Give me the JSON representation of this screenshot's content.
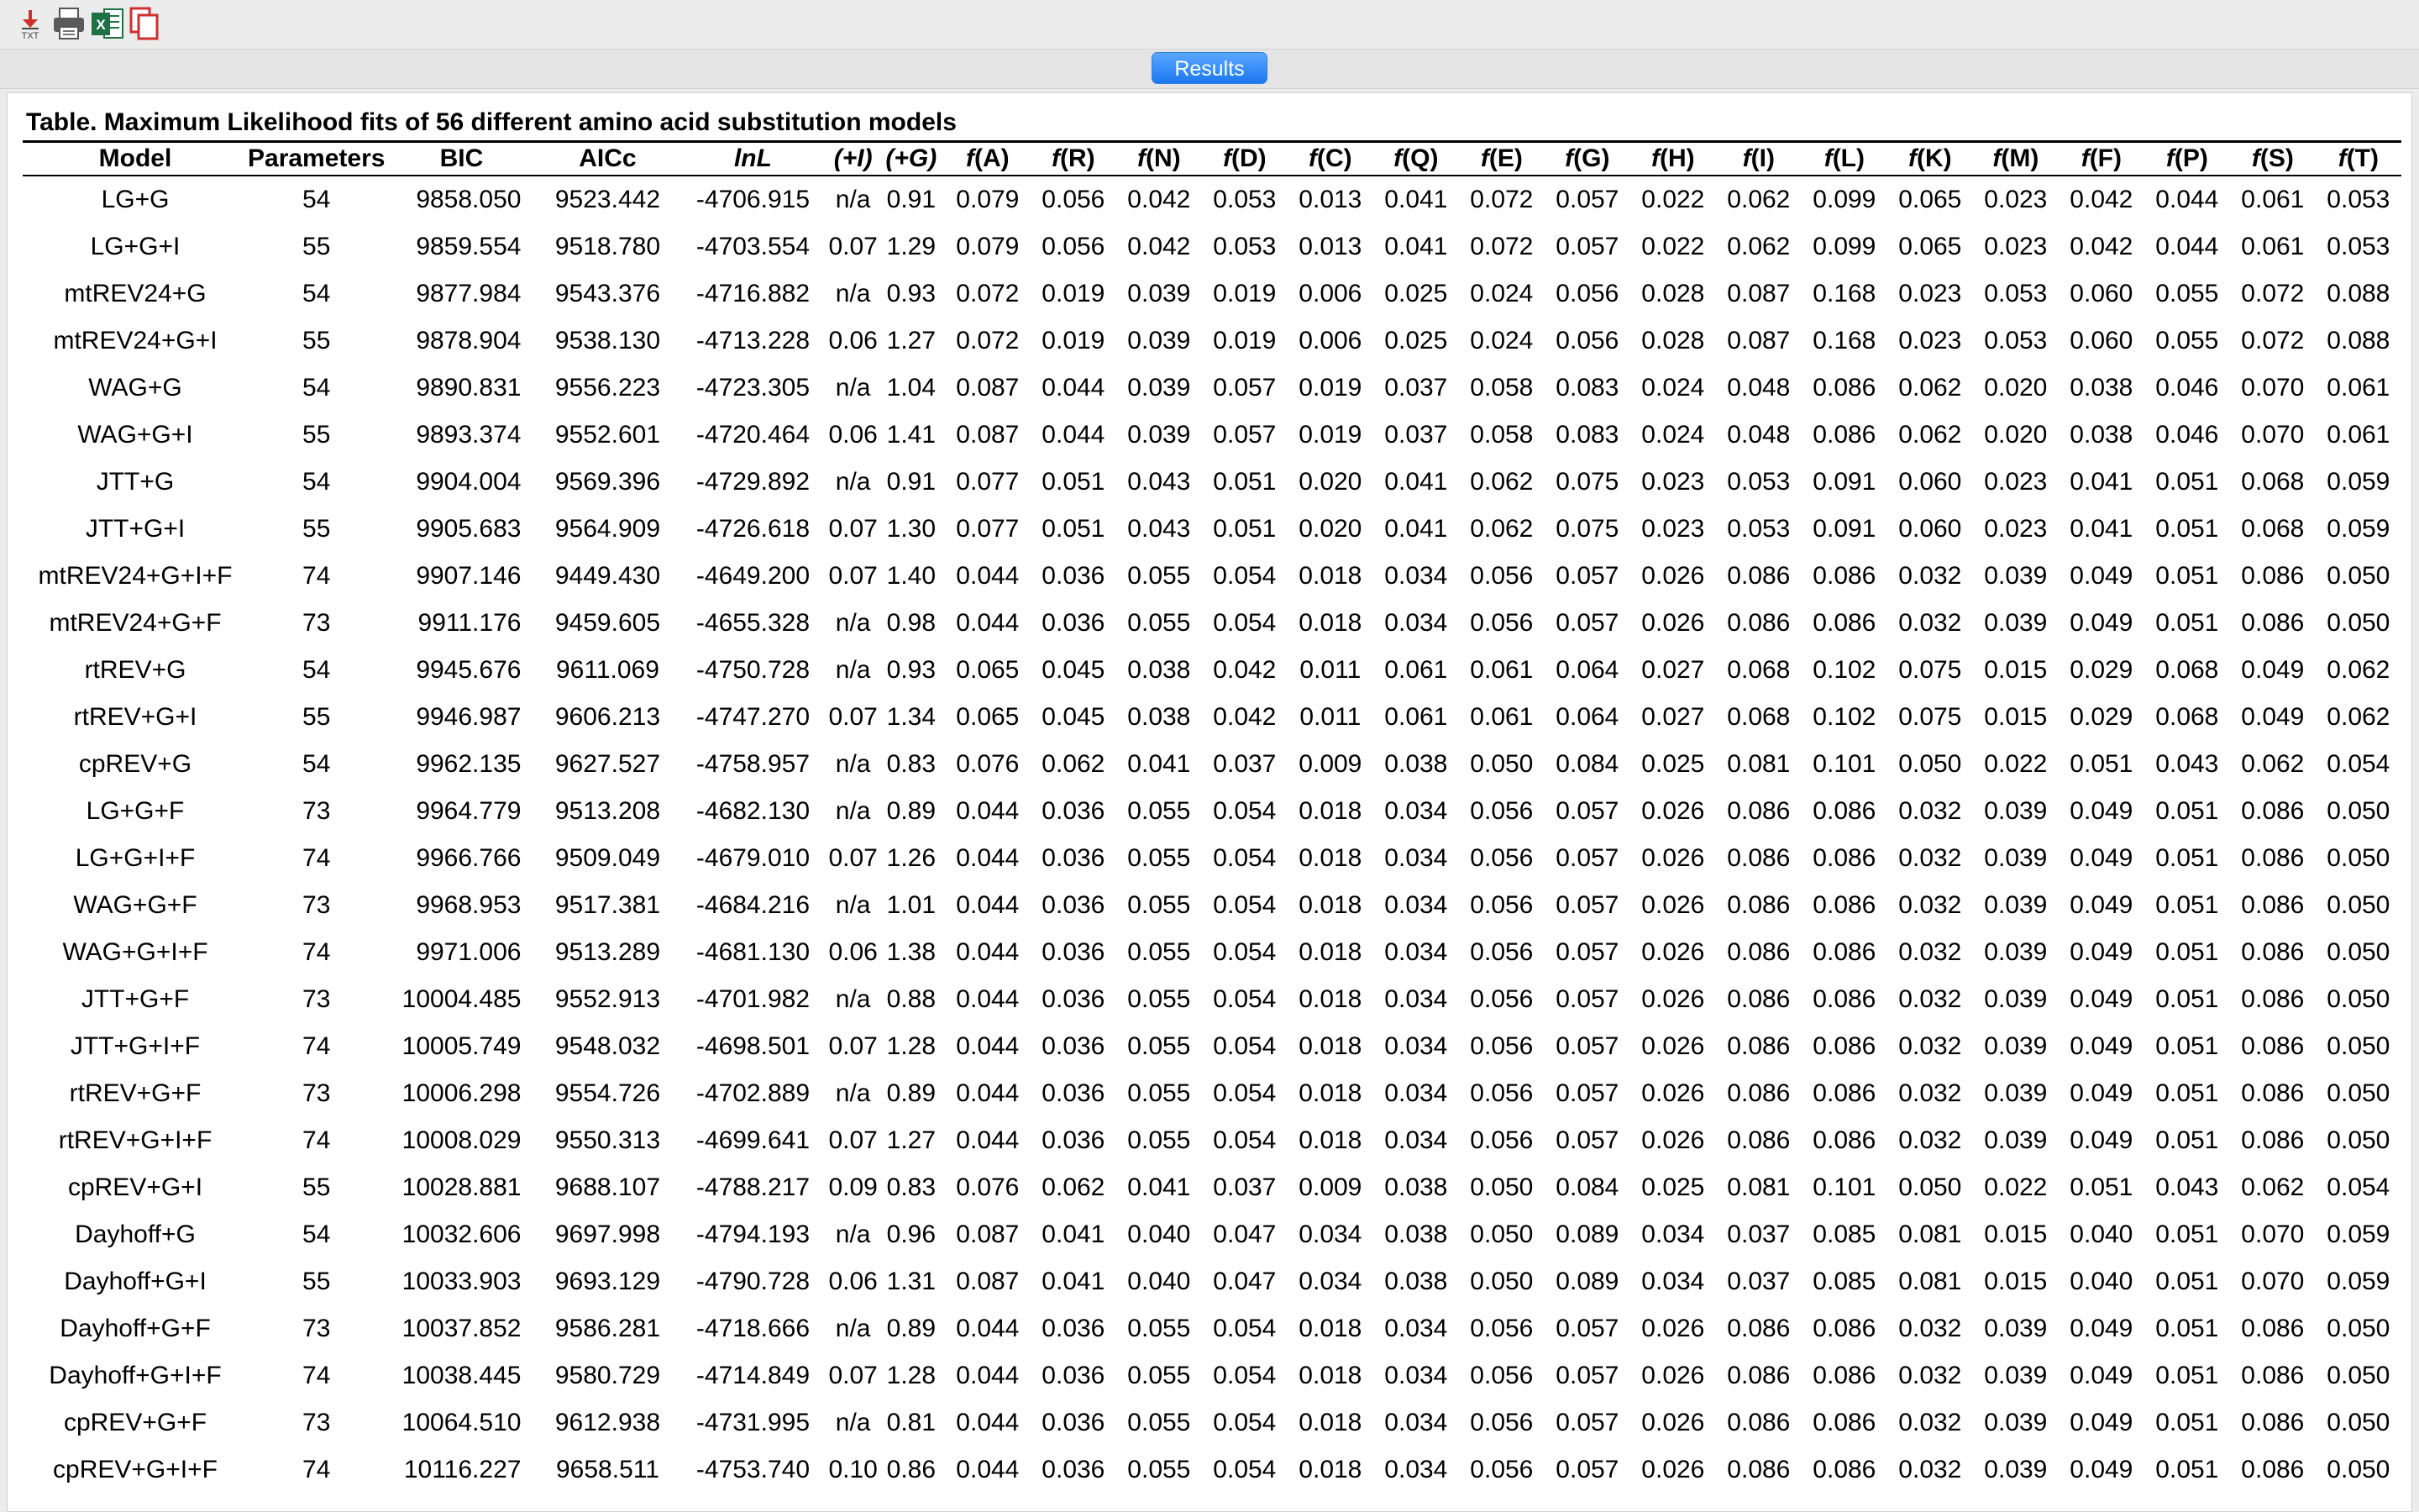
{
  "toolbar": {
    "buttons": [
      {
        "name": "export-txt-button",
        "icon": "txt-export-icon",
        "label": "TXT"
      },
      {
        "name": "print-button",
        "icon": "printer-icon"
      },
      {
        "name": "export-excel-button",
        "icon": "excel-icon",
        "label": "X"
      },
      {
        "name": "copy-button",
        "icon": "copy-icon"
      }
    ]
  },
  "tabs": {
    "active_label": "Results",
    "accent_color": "#1c78f0"
  },
  "table": {
    "caption": "Table. Maximum Likelihood fits of 56 different amino acid substitution models",
    "headers": [
      "Model",
      "Parameters",
      "BIC",
      "AICc",
      "lnL",
      "(+I)",
      "(+G)",
      "f(A)",
      "f(R)",
      "f(N)",
      "f(D)",
      "f(C)",
      "f(Q)",
      "f(E)",
      "f(G)",
      "f(H)",
      "f(I)",
      "f(L)",
      "f(K)",
      "f(M)",
      "f(F)",
      "f(P)",
      "f(S)",
      "f(T)"
    ],
    "rows": [
      [
        "LG+G",
        "54",
        "9858.050",
        "9523.442",
        "-4706.915",
        "n/a",
        "0.91",
        "0.079",
        "0.056",
        "0.042",
        "0.053",
        "0.013",
        "0.041",
        "0.072",
        "0.057",
        "0.022",
        "0.062",
        "0.099",
        "0.065",
        "0.023",
        "0.042",
        "0.044",
        "0.061",
        "0.053"
      ],
      [
        "LG+G+I",
        "55",
        "9859.554",
        "9518.780",
        "-4703.554",
        "0.07",
        "1.29",
        "0.079",
        "0.056",
        "0.042",
        "0.053",
        "0.013",
        "0.041",
        "0.072",
        "0.057",
        "0.022",
        "0.062",
        "0.099",
        "0.065",
        "0.023",
        "0.042",
        "0.044",
        "0.061",
        "0.053"
      ],
      [
        "mtREV24+G",
        "54",
        "9877.984",
        "9543.376",
        "-4716.882",
        "n/a",
        "0.93",
        "0.072",
        "0.019",
        "0.039",
        "0.019",
        "0.006",
        "0.025",
        "0.024",
        "0.056",
        "0.028",
        "0.087",
        "0.168",
        "0.023",
        "0.053",
        "0.060",
        "0.055",
        "0.072",
        "0.088"
      ],
      [
        "mtREV24+G+I",
        "55",
        "9878.904",
        "9538.130",
        "-4713.228",
        "0.06",
        "1.27",
        "0.072",
        "0.019",
        "0.039",
        "0.019",
        "0.006",
        "0.025",
        "0.024",
        "0.056",
        "0.028",
        "0.087",
        "0.168",
        "0.023",
        "0.053",
        "0.060",
        "0.055",
        "0.072",
        "0.088"
      ],
      [
        "WAG+G",
        "54",
        "9890.831",
        "9556.223",
        "-4723.305",
        "n/a",
        "1.04",
        "0.087",
        "0.044",
        "0.039",
        "0.057",
        "0.019",
        "0.037",
        "0.058",
        "0.083",
        "0.024",
        "0.048",
        "0.086",
        "0.062",
        "0.020",
        "0.038",
        "0.046",
        "0.070",
        "0.061"
      ],
      [
        "WAG+G+I",
        "55",
        "9893.374",
        "9552.601",
        "-4720.464",
        "0.06",
        "1.41",
        "0.087",
        "0.044",
        "0.039",
        "0.057",
        "0.019",
        "0.037",
        "0.058",
        "0.083",
        "0.024",
        "0.048",
        "0.086",
        "0.062",
        "0.020",
        "0.038",
        "0.046",
        "0.070",
        "0.061"
      ],
      [
        "JTT+G",
        "54",
        "9904.004",
        "9569.396",
        "-4729.892",
        "n/a",
        "0.91",
        "0.077",
        "0.051",
        "0.043",
        "0.051",
        "0.020",
        "0.041",
        "0.062",
        "0.075",
        "0.023",
        "0.053",
        "0.091",
        "0.060",
        "0.023",
        "0.041",
        "0.051",
        "0.068",
        "0.059"
      ],
      [
        "JTT+G+I",
        "55",
        "9905.683",
        "9564.909",
        "-4726.618",
        "0.07",
        "1.30",
        "0.077",
        "0.051",
        "0.043",
        "0.051",
        "0.020",
        "0.041",
        "0.062",
        "0.075",
        "0.023",
        "0.053",
        "0.091",
        "0.060",
        "0.023",
        "0.041",
        "0.051",
        "0.068",
        "0.059"
      ],
      [
        "mtREV24+G+I+F",
        "74",
        "9907.146",
        "9449.430",
        "-4649.200",
        "0.07",
        "1.40",
        "0.044",
        "0.036",
        "0.055",
        "0.054",
        "0.018",
        "0.034",
        "0.056",
        "0.057",
        "0.026",
        "0.086",
        "0.086",
        "0.032",
        "0.039",
        "0.049",
        "0.051",
        "0.086",
        "0.050"
      ],
      [
        "mtREV24+G+F",
        "73",
        "9911.176",
        "9459.605",
        "-4655.328",
        "n/a",
        "0.98",
        "0.044",
        "0.036",
        "0.055",
        "0.054",
        "0.018",
        "0.034",
        "0.056",
        "0.057",
        "0.026",
        "0.086",
        "0.086",
        "0.032",
        "0.039",
        "0.049",
        "0.051",
        "0.086",
        "0.050"
      ],
      [
        "rtREV+G",
        "54",
        "9945.676",
        "9611.069",
        "-4750.728",
        "n/a",
        "0.93",
        "0.065",
        "0.045",
        "0.038",
        "0.042",
        "0.011",
        "0.061",
        "0.061",
        "0.064",
        "0.027",
        "0.068",
        "0.102",
        "0.075",
        "0.015",
        "0.029",
        "0.068",
        "0.049",
        "0.062"
      ],
      [
        "rtREV+G+I",
        "55",
        "9946.987",
        "9606.213",
        "-4747.270",
        "0.07",
        "1.34",
        "0.065",
        "0.045",
        "0.038",
        "0.042",
        "0.011",
        "0.061",
        "0.061",
        "0.064",
        "0.027",
        "0.068",
        "0.102",
        "0.075",
        "0.015",
        "0.029",
        "0.068",
        "0.049",
        "0.062"
      ],
      [
        "cpREV+G",
        "54",
        "9962.135",
        "9627.527",
        "-4758.957",
        "n/a",
        "0.83",
        "0.076",
        "0.062",
        "0.041",
        "0.037",
        "0.009",
        "0.038",
        "0.050",
        "0.084",
        "0.025",
        "0.081",
        "0.101",
        "0.050",
        "0.022",
        "0.051",
        "0.043",
        "0.062",
        "0.054"
      ],
      [
        "LG+G+F",
        "73",
        "9964.779",
        "9513.208",
        "-4682.130",
        "n/a",
        "0.89",
        "0.044",
        "0.036",
        "0.055",
        "0.054",
        "0.018",
        "0.034",
        "0.056",
        "0.057",
        "0.026",
        "0.086",
        "0.086",
        "0.032",
        "0.039",
        "0.049",
        "0.051",
        "0.086",
        "0.050"
      ],
      [
        "LG+G+I+F",
        "74",
        "9966.766",
        "9509.049",
        "-4679.010",
        "0.07",
        "1.26",
        "0.044",
        "0.036",
        "0.055",
        "0.054",
        "0.018",
        "0.034",
        "0.056",
        "0.057",
        "0.026",
        "0.086",
        "0.086",
        "0.032",
        "0.039",
        "0.049",
        "0.051",
        "0.086",
        "0.050"
      ],
      [
        "WAG+G+F",
        "73",
        "9968.953",
        "9517.381",
        "-4684.216",
        "n/a",
        "1.01",
        "0.044",
        "0.036",
        "0.055",
        "0.054",
        "0.018",
        "0.034",
        "0.056",
        "0.057",
        "0.026",
        "0.086",
        "0.086",
        "0.032",
        "0.039",
        "0.049",
        "0.051",
        "0.086",
        "0.050"
      ],
      [
        "WAG+G+I+F",
        "74",
        "9971.006",
        "9513.289",
        "-4681.130",
        "0.06",
        "1.38",
        "0.044",
        "0.036",
        "0.055",
        "0.054",
        "0.018",
        "0.034",
        "0.056",
        "0.057",
        "0.026",
        "0.086",
        "0.086",
        "0.032",
        "0.039",
        "0.049",
        "0.051",
        "0.086",
        "0.050"
      ],
      [
        "JTT+G+F",
        "73",
        "10004.485",
        "9552.913",
        "-4701.982",
        "n/a",
        "0.88",
        "0.044",
        "0.036",
        "0.055",
        "0.054",
        "0.018",
        "0.034",
        "0.056",
        "0.057",
        "0.026",
        "0.086",
        "0.086",
        "0.032",
        "0.039",
        "0.049",
        "0.051",
        "0.086",
        "0.050"
      ],
      [
        "JTT+G+I+F",
        "74",
        "10005.749",
        "9548.032",
        "-4698.501",
        "0.07",
        "1.28",
        "0.044",
        "0.036",
        "0.055",
        "0.054",
        "0.018",
        "0.034",
        "0.056",
        "0.057",
        "0.026",
        "0.086",
        "0.086",
        "0.032",
        "0.039",
        "0.049",
        "0.051",
        "0.086",
        "0.050"
      ],
      [
        "rtREV+G+F",
        "73",
        "10006.298",
        "9554.726",
        "-4702.889",
        "n/a",
        "0.89",
        "0.044",
        "0.036",
        "0.055",
        "0.054",
        "0.018",
        "0.034",
        "0.056",
        "0.057",
        "0.026",
        "0.086",
        "0.086",
        "0.032",
        "0.039",
        "0.049",
        "0.051",
        "0.086",
        "0.050"
      ],
      [
        "rtREV+G+I+F",
        "74",
        "10008.029",
        "9550.313",
        "-4699.641",
        "0.07",
        "1.27",
        "0.044",
        "0.036",
        "0.055",
        "0.054",
        "0.018",
        "0.034",
        "0.056",
        "0.057",
        "0.026",
        "0.086",
        "0.086",
        "0.032",
        "0.039",
        "0.049",
        "0.051",
        "0.086",
        "0.050"
      ],
      [
        "cpREV+G+I",
        "55",
        "10028.881",
        "9688.107",
        "-4788.217",
        "0.09",
        "0.83",
        "0.076",
        "0.062",
        "0.041",
        "0.037",
        "0.009",
        "0.038",
        "0.050",
        "0.084",
        "0.025",
        "0.081",
        "0.101",
        "0.050",
        "0.022",
        "0.051",
        "0.043",
        "0.062",
        "0.054"
      ],
      [
        "Dayhoff+G",
        "54",
        "10032.606",
        "9697.998",
        "-4794.193",
        "n/a",
        "0.96",
        "0.087",
        "0.041",
        "0.040",
        "0.047",
        "0.034",
        "0.038",
        "0.050",
        "0.089",
        "0.034",
        "0.037",
        "0.085",
        "0.081",
        "0.015",
        "0.040",
        "0.051",
        "0.070",
        "0.059"
      ],
      [
        "Dayhoff+G+I",
        "55",
        "10033.903",
        "9693.129",
        "-4790.728",
        "0.06",
        "1.31",
        "0.087",
        "0.041",
        "0.040",
        "0.047",
        "0.034",
        "0.038",
        "0.050",
        "0.089",
        "0.034",
        "0.037",
        "0.085",
        "0.081",
        "0.015",
        "0.040",
        "0.051",
        "0.070",
        "0.059"
      ],
      [
        "Dayhoff+G+F",
        "73",
        "10037.852",
        "9586.281",
        "-4718.666",
        "n/a",
        "0.89",
        "0.044",
        "0.036",
        "0.055",
        "0.054",
        "0.018",
        "0.034",
        "0.056",
        "0.057",
        "0.026",
        "0.086",
        "0.086",
        "0.032",
        "0.039",
        "0.049",
        "0.051",
        "0.086",
        "0.050"
      ],
      [
        "Dayhoff+G+I+F",
        "74",
        "10038.445",
        "9580.729",
        "-4714.849",
        "0.07",
        "1.28",
        "0.044",
        "0.036",
        "0.055",
        "0.054",
        "0.018",
        "0.034",
        "0.056",
        "0.057",
        "0.026",
        "0.086",
        "0.086",
        "0.032",
        "0.039",
        "0.049",
        "0.051",
        "0.086",
        "0.050"
      ],
      [
        "cpREV+G+F",
        "73",
        "10064.510",
        "9612.938",
        "-4731.995",
        "n/a",
        "0.81",
        "0.044",
        "0.036",
        "0.055",
        "0.054",
        "0.018",
        "0.034",
        "0.056",
        "0.057",
        "0.026",
        "0.086",
        "0.086",
        "0.032",
        "0.039",
        "0.049",
        "0.051",
        "0.086",
        "0.050"
      ],
      [
        "cpREV+G+I+F",
        "74",
        "10116.227",
        "9658.511",
        "-4753.740",
        "0.10",
        "0.86",
        "0.044",
        "0.036",
        "0.055",
        "0.054",
        "0.018",
        "0.034",
        "0.056",
        "0.057",
        "0.026",
        "0.086",
        "0.086",
        "0.032",
        "0.039",
        "0.049",
        "0.051",
        "0.086",
        "0.050"
      ]
    ]
  }
}
